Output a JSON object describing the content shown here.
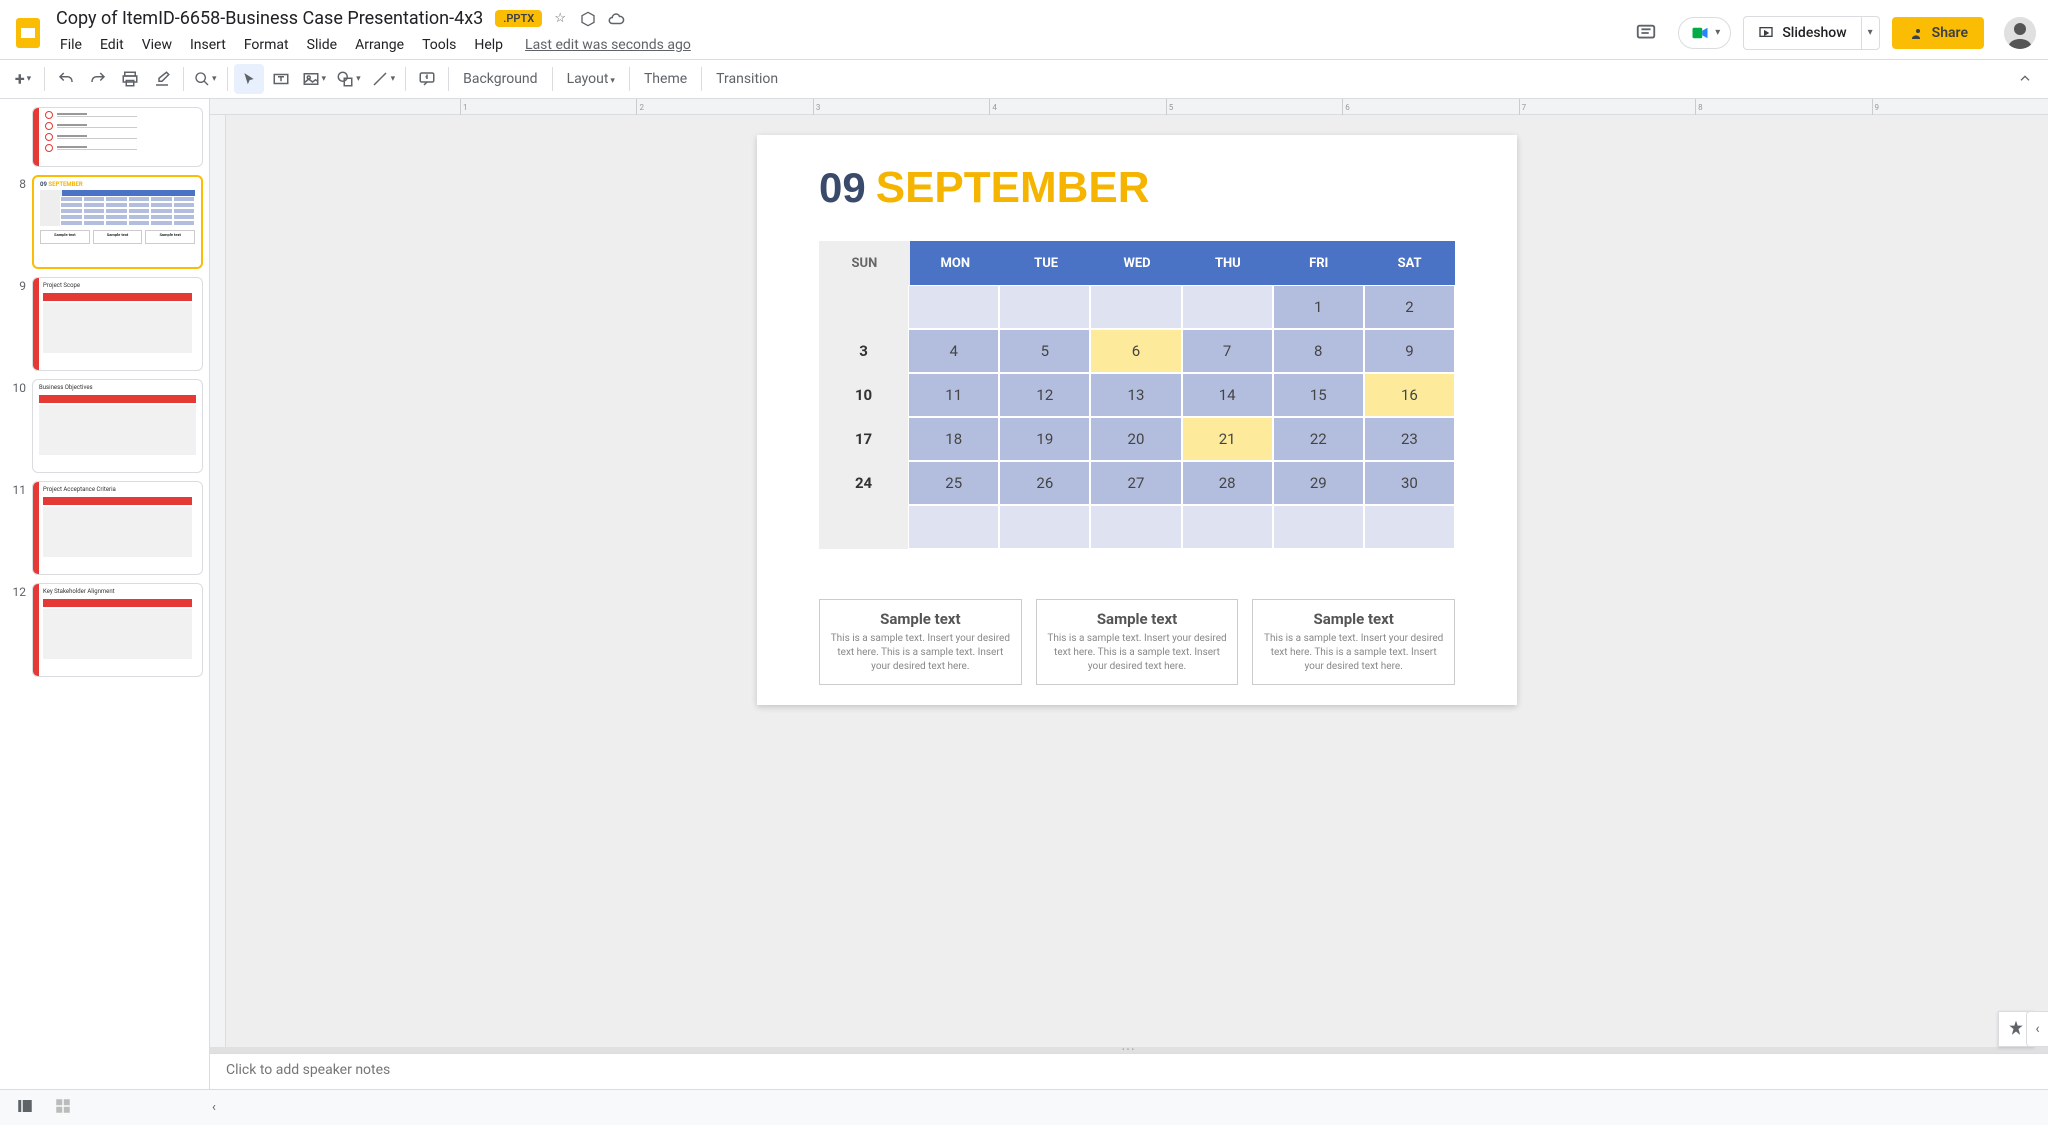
{
  "app": {
    "title": "Copy of ItemID-6658-Business Case Presentation-4x3",
    "badge": ".PPTX"
  },
  "menu": {
    "items": [
      "File",
      "Edit",
      "View",
      "Insert",
      "Format",
      "Slide",
      "Arrange",
      "Tools",
      "Help"
    ],
    "last_edit": "Last edit was seconds ago"
  },
  "header": {
    "slideshow": "Slideshow",
    "share": "Share"
  },
  "toolbar": {
    "background": "Background",
    "layout": "Layout",
    "theme": "Theme",
    "transition": "Transition"
  },
  "filmstrip": {
    "visible_slides": [
      {
        "n": "",
        "title": ""
      },
      {
        "n": "8",
        "title": "09 SEPTEMBER",
        "selected": true
      },
      {
        "n": "9",
        "title": "Project Scope"
      },
      {
        "n": "10",
        "title": "Business Objectives"
      },
      {
        "n": "11",
        "title": "Project Acceptance Criteria"
      },
      {
        "n": "12",
        "title": "Key Stakeholder Alignment"
      }
    ]
  },
  "slide": {
    "month_num": "09",
    "month_name": "SEPTEMBER",
    "days": [
      "SUN",
      "MON",
      "TUE",
      "WED",
      "THU",
      "FRI",
      "SAT"
    ],
    "rows": [
      [
        "",
        "",
        "",
        "",
        "",
        "1",
        "2"
      ],
      [
        "3",
        "4",
        "5",
        "6",
        "7",
        "8",
        "9"
      ],
      [
        "10",
        "11",
        "12",
        "13",
        "14",
        "15",
        "16"
      ],
      [
        "17",
        "18",
        "19",
        "20",
        "21",
        "22",
        "23"
      ],
      [
        "24",
        "25",
        "26",
        "27",
        "28",
        "29",
        "30"
      ],
      [
        "",
        "",
        "",
        "",
        "",
        "",
        ""
      ]
    ],
    "highlights": [
      [
        1,
        3
      ],
      [
        2,
        6
      ],
      [
        3,
        4
      ]
    ],
    "boxes": [
      {
        "title": "Sample text",
        "body": "This is a sample text. Insert your desired text here. This is a sample text. Insert your desired text here."
      },
      {
        "title": "Sample text",
        "body": "This is a sample text. Insert your desired text here. This is a sample text. Insert your desired text here."
      },
      {
        "title": "Sample text",
        "body": "This is a sample text. Insert your desired text here. This is a sample text. Insert your desired text here."
      }
    ]
  },
  "notes": {
    "placeholder": "Click to add speaker notes"
  },
  "ruler_labels": [
    "1",
    "2",
    "3",
    "4",
    "5",
    "6",
    "7",
    "8",
    "9"
  ]
}
